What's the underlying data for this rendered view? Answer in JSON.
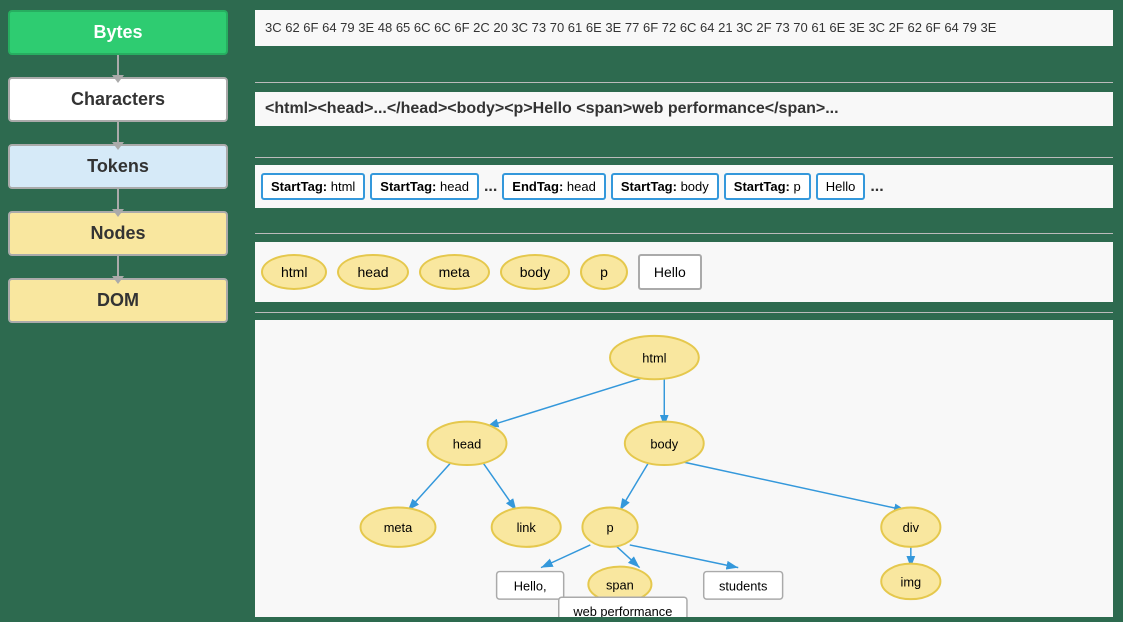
{
  "pipeline": {
    "bytes_label": "Bytes",
    "characters_label": "Characters",
    "tokens_label": "Tokens",
    "nodes_label": "Nodes",
    "dom_label": "DOM"
  },
  "bytes_hex": "3C 62 6F 64 79 3E 48 65 6C 6C 6F 2C 20 3C 73 70 61 6E 3E 77 6F 72 6C 64 21 3C 2F 73 70 61 6E 3E 3C 2F 62 6F 64 79 3E",
  "characters_text": "<html><head>...</head><body><p>Hello <span>web performance</span>...",
  "tokens": [
    {
      "type": "StartTag",
      "value": "html"
    },
    {
      "type": "StartTag",
      "value": "head"
    },
    {
      "type": "ellipsis",
      "value": "..."
    },
    {
      "type": "EndTag",
      "value": "head"
    },
    {
      "type": "StartTag",
      "value": "body"
    },
    {
      "type": "StartTag",
      "value": "p"
    },
    {
      "type": "text",
      "value": "Hello"
    },
    {
      "type": "ellipsis2",
      "value": "..."
    }
  ],
  "nodes": [
    "html",
    "head",
    "meta",
    "body",
    "p",
    "Hello"
  ],
  "dom_tree": {
    "root": "html",
    "children": {
      "html": [
        "head",
        "body"
      ],
      "head": [
        "meta",
        "link"
      ],
      "body": [
        "p",
        "div"
      ],
      "p": [
        "Hello,",
        "span",
        "students"
      ],
      "div": [
        "img"
      ],
      "span": [
        "web performance"
      ]
    }
  },
  "colors": {
    "green_box": "#2ecc71",
    "blue_border": "#3498db",
    "yellow_oval": "#f9e79f",
    "arrow_color": "#3498db"
  }
}
